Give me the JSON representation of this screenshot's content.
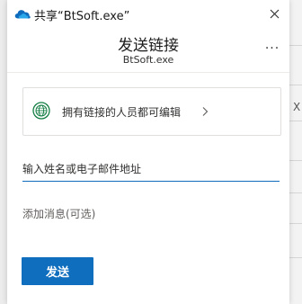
{
  "window": {
    "title": "共享“BtSoft.exe”",
    "close_icon": "close-icon",
    "app_icon": "onedrive-cloud-icon"
  },
  "header": {
    "title": "发送链接",
    "subtitle": "BtSoft.exe",
    "more_label": "..."
  },
  "permission": {
    "label": "拥有链接的人员都可编辑",
    "icon": "globe-icon",
    "chevron": "chevron-right-icon"
  },
  "recipients": {
    "placeholder": "输入姓名或电子邮件地址"
  },
  "message": {
    "placeholder": "添加消息(可选)"
  },
  "actions": {
    "send_label": "发送"
  },
  "background": {
    "right_glyph": "X"
  },
  "colors": {
    "accent": "#106ebe",
    "globe_green": "#107c41"
  }
}
